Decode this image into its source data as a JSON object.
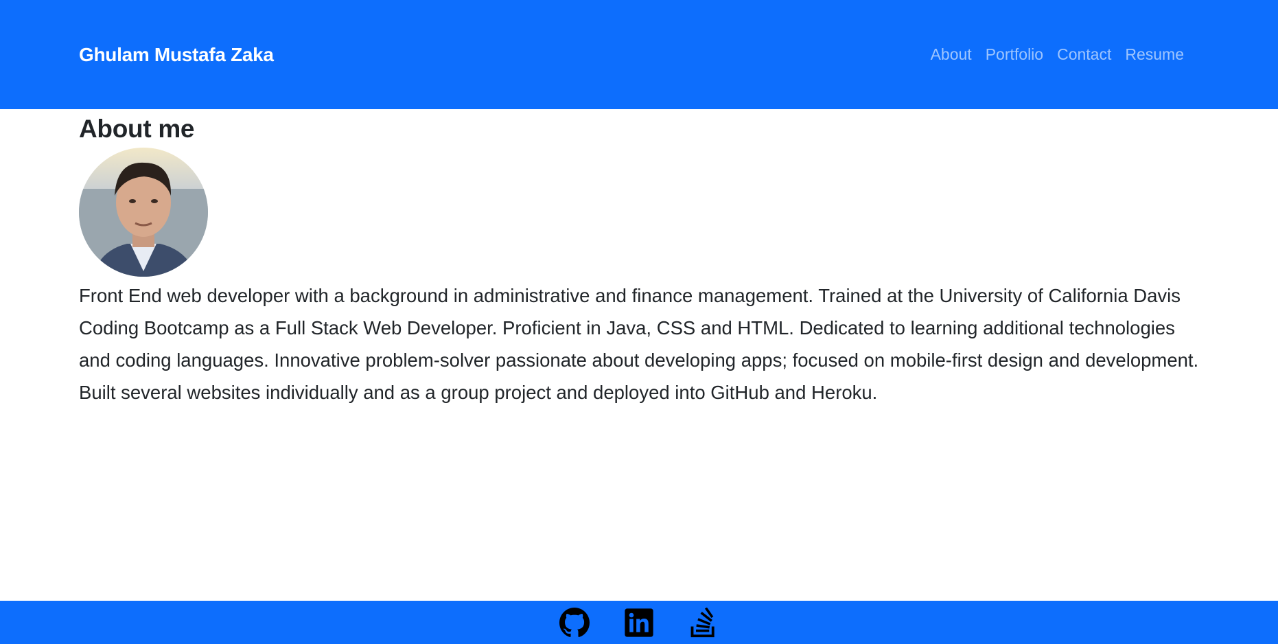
{
  "header": {
    "brand": "Ghulam Mustafa Zaka",
    "nav": [
      "About",
      "Portfolio",
      "Contact",
      "Resume"
    ]
  },
  "main": {
    "title": "About me",
    "bio": "Front End web developer with a background in administrative and finance management. Trained at the University of California Davis Coding Bootcamp as a Full Stack Web Developer. Proficient in Java, CSS and HTML. Dedicated to learning additional technologies and coding languages. Innovative problem-solver passionate about developing apps; focused on mobile-first design and development. Built several websites individually and as a group project and deployed into GitHub and Heroku."
  },
  "footer": {
    "icons": [
      "github-icon",
      "linkedin-icon",
      "stackoverflow-icon"
    ]
  },
  "colors": {
    "primary": "#0d6efd"
  }
}
